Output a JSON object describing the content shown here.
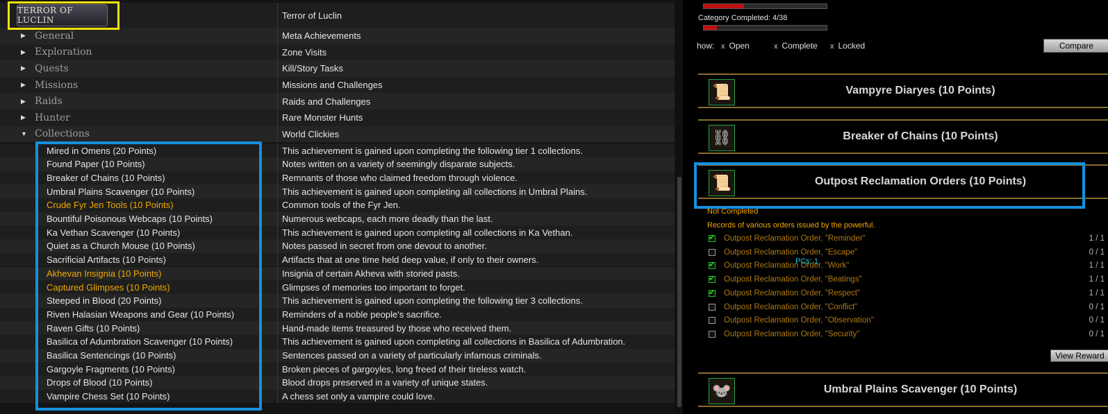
{
  "logo_text": "TERROR OF LUCLIN",
  "tree": {
    "top": {
      "name": "Terror of Luclin",
      "desc": "Terror of Luclin"
    },
    "categories": [
      {
        "name": "General",
        "desc": "Meta Achievements",
        "arrow": "▶"
      },
      {
        "name": "Exploration",
        "desc": "Zone Visits",
        "arrow": "▶"
      },
      {
        "name": "Quests",
        "desc": "Kill/Story Tasks",
        "arrow": "▶"
      },
      {
        "name": "Missions",
        "desc": "Missions and Challenges",
        "arrow": "▶"
      },
      {
        "name": "Raids",
        "desc": "Raids and Challenges",
        "arrow": "▶"
      },
      {
        "name": "Hunter",
        "desc": "Rare Monster Hunts",
        "arrow": "▶"
      },
      {
        "name": "Collections",
        "desc": "World Clickies",
        "arrow": "▼"
      }
    ],
    "collections": [
      {
        "name": "Mired in Omens (20 Points)",
        "desc": "This achievement is gained upon completing the following tier 1 collections.",
        "color": "#e6e6e6"
      },
      {
        "name": "Found Paper (10 Points)",
        "desc": "Notes written on a variety of seemingly disparate subjects.",
        "color": "#e6e6e6"
      },
      {
        "name": "Breaker of Chains (10 Points)",
        "desc": "Remnants of those who claimed freedom through violence.",
        "color": "#e6e6e6"
      },
      {
        "name": "Umbral Plains Scavenger (10 Points)",
        "desc": "This achievement is gained upon completing all collections in Umbral Plains.",
        "color": "#e6e6e6"
      },
      {
        "name": "Crude Fyr Jen Tools (10 Points)",
        "desc": "Common tools of the Fyr Jen.",
        "color": "#f0a800"
      },
      {
        "name": "Bountiful Poisonous Webcaps (10 Points)",
        "desc": "Numerous webcaps, each more deadly than the last.",
        "color": "#e6e6e6"
      },
      {
        "name": "Ka Vethan Scavenger (10 Points)",
        "desc": "This achievement is gained upon completing all collections in Ka Vethan.",
        "color": "#e6e6e6"
      },
      {
        "name": "Quiet as a Church Mouse (10 Points)",
        "desc": "Notes passed in secret from one devout to another.",
        "color": "#e6e6e6"
      },
      {
        "name": "Sacrificial Artifacts (10 Points)",
        "desc": "Artifacts that at one time held deep value, if only to their owners.",
        "color": "#e6e6e6"
      },
      {
        "name": "Akhevan Insignia (10 Points)",
        "desc": "Insignia of certain Akheva with storied pasts.",
        "color": "#f0a800"
      },
      {
        "name": "Captured Glimpses (10 Points)",
        "desc": "Glimpses of memories too important to forget.",
        "color": "#f0a800"
      },
      {
        "name": "Steeped in Blood (20 Points)",
        "desc": "This achievement is gained upon completing the following tier 3 collections.",
        "color": "#e6e6e6"
      },
      {
        "name": "Riven Halasian Weapons and Gear (10 Points)",
        "desc": "Reminders of a noble people's sacrifice.",
        "color": "#e6e6e6"
      },
      {
        "name": "Raven Gifts (10 Points)",
        "desc": "Hand-made items treasured by those who received them.",
        "color": "#e6e6e6"
      },
      {
        "name": "Basilica of Adumbration Scavenger (10 Points)",
        "desc": "This achievement is gained upon completing all collections in Basilica of Adumbration.",
        "color": "#e6e6e6"
      },
      {
        "name": "Basilica Sentencings (10 Points)",
        "desc": "Sentences passed on a variety of particularly infamous criminals.",
        "color": "#e6e6e6"
      },
      {
        "name": "Gargoyle Fragments (10 Points)",
        "desc": "Broken pieces of gargoyles, long freed of their tireless watch.",
        "color": "#e6e6e6"
      },
      {
        "name": "Drops of Blood (10 Points)",
        "desc": "Blood drops preserved in a variety of unique states.",
        "color": "#e6e6e6"
      },
      {
        "name": "Vampire Chess Set (10 Points)",
        "desc": "A chess set only a vampire could love.",
        "color": "#e6e6e6"
      }
    ]
  },
  "right": {
    "category_completed": "Category Completed: 4/38",
    "progress_top": 0.33,
    "progress_bottom": 0.105,
    "show_label": "how:",
    "filters": [
      {
        "x": "x",
        "label": "Open"
      },
      {
        "x": "x",
        "label": "Complete"
      },
      {
        "x": "x",
        "label": "Locked"
      }
    ],
    "compare_label": "Compare",
    "achievements": [
      {
        "title": "Vampyre Diaryes (10 Points)",
        "icon": "📜",
        "icon_name": "scroll-icon"
      },
      {
        "title": "Breaker of Chains (10 Points)",
        "icon": "⛓",
        "icon_name": "chains-icon"
      },
      {
        "title": "Outpost Reclamation Orders (10 Points)",
        "icon": "📜",
        "icon_name": "sealed-scroll-icon"
      },
      {
        "title": "Umbral Plains Scavenger (10 Points)",
        "icon": "🐭",
        "icon_name": "creature-icon"
      }
    ],
    "status": "Not Completed",
    "description": "Records of various orders issued by the powerful.",
    "orders": [
      {
        "label": "Outpost Reclamation Order, \"Reminder\"",
        "count": "1 / 1",
        "checked": true
      },
      {
        "label": "Outpost Reclamation Order, \"Escape\"",
        "count": "0 / 1",
        "checked": false
      },
      {
        "label": "Outpost Reclamation Order, \"Work\"",
        "count": "1 / 1",
        "checked": true
      },
      {
        "label": "Outpost Reclamation Order, \"Beatings\"",
        "count": "1 / 1",
        "checked": true
      },
      {
        "label": "Outpost Reclamation Order, \"Respect\"",
        "count": "1 / 1",
        "checked": true
      },
      {
        "label": "Outpost Reclamation Order, \"Conflict\"",
        "count": "0 / 1",
        "checked": false
      },
      {
        "label": "Outpost Reclamation Order, \"Observation\"",
        "count": "0 / 1",
        "checked": false
      },
      {
        "label": "Outpost Reclamation Order, \"Security\"",
        "count": "0 / 1",
        "checked": false
      }
    ],
    "pcs_label": "PCs: 1",
    "view_reward_label": "View Reward"
  }
}
